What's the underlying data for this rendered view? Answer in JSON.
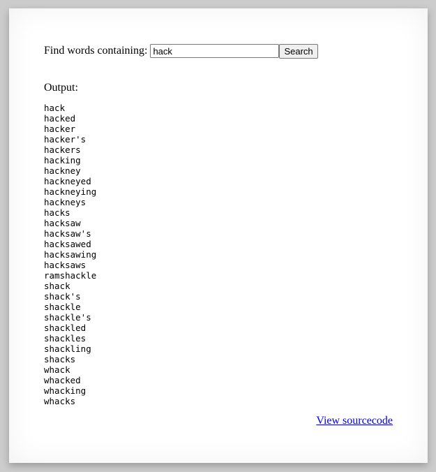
{
  "form": {
    "label": "Find words containing:",
    "input_value": "hack",
    "button_label": "Search"
  },
  "output_label": "Output:",
  "results": [
    "hack",
    "hacked",
    "hacker",
    "hacker's",
    "hackers",
    "hacking",
    "hackney",
    "hackneyed",
    "hackneying",
    "hackneys",
    "hacks",
    "hacksaw",
    "hacksaw's",
    "hacksawed",
    "hacksawing",
    "hacksaws",
    "ramshackle",
    "shack",
    "shack's",
    "shackle",
    "shackle's",
    "shackled",
    "shackles",
    "shackling",
    "shacks",
    "whack",
    "whacked",
    "whacking",
    "whacks"
  ],
  "footer": {
    "link_label": "View sourcecode"
  },
  "colors": {
    "link": "#0000ee",
    "background": "#cccccc"
  }
}
